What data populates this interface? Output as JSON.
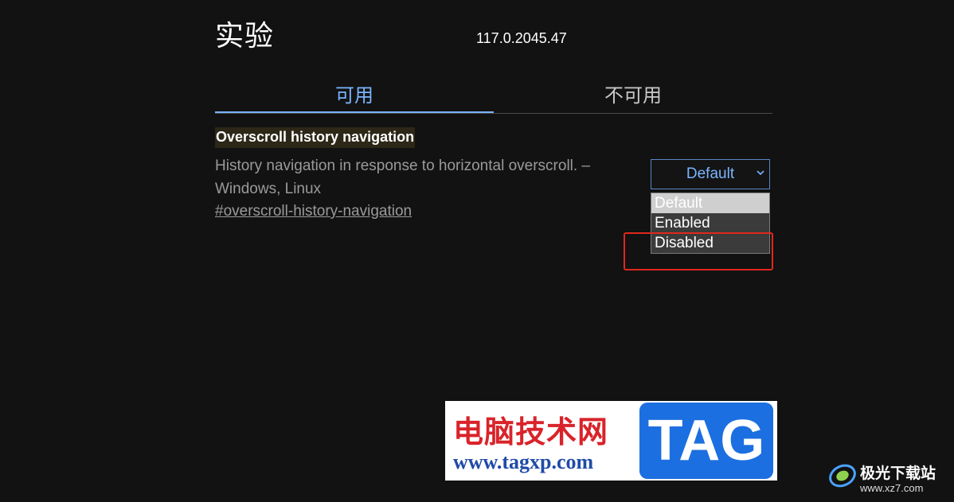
{
  "header": {
    "title": "实验",
    "version": "117.0.2045.47"
  },
  "tabs": [
    {
      "label": "可用",
      "active": true
    },
    {
      "label": "不可用",
      "active": false
    }
  ],
  "experiment": {
    "name": "Overscroll history navigation",
    "description": "History navigation in response to horizontal overscroll. – Windows, Linux",
    "link": "#overscroll-history-navigation",
    "select": {
      "value": "Default",
      "chevron_icon": "chevron-down-icon",
      "options": [
        {
          "label": "Default",
          "selected": true
        },
        {
          "label": "Enabled",
          "selected": false
        },
        {
          "label": "Disabled",
          "selected": false
        }
      ]
    }
  },
  "watermark": {
    "cn_text": "电脑技术网",
    "url": "www.tagxp.com",
    "tag": "TAG",
    "site_name": "极光下载站",
    "site_url": "www.xz7.com"
  },
  "colors": {
    "accent": "#7ab4ff",
    "highlight_box": "#e0271d",
    "background": "#121212"
  }
}
